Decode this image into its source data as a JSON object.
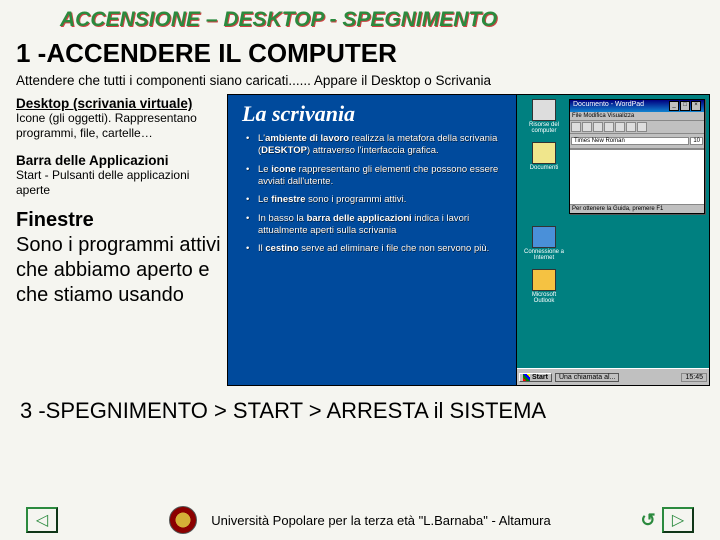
{
  "slide": {
    "title": "ACCENSIONE – DESKTOP - SPEGNIMENTO",
    "heading": "1 -ACCENDERE IL COMPUTER",
    "subtext": "Attendere che tutti i componenti siano caricati...... Appare il Desktop o Scrivania",
    "left": {
      "t1": "Desktop (scrivania virtuale)",
      "d1": "Icone (gli oggetti). Rappresentano programmi, file, cartelle…",
      "t2": "Barra delle Applicazioni",
      "d2": "Start - Pulsanti delle applicazioni aperte",
      "t3": "Finestre",
      "d3": "Sono i programmi attivi che abbiamo aperto e che stiamo usando"
    },
    "bottom": "3 -SPEGNIMENTO > START > ARRESTA il SISTEMA",
    "footer": "Università Popolare per la terza età \"L.Barnaba\" - Altamura"
  },
  "screenshot": {
    "title": "La scrivania",
    "bullets": [
      "L'ambiente di lavoro realizza la metafora della scrivania (DESKTOP) attraverso l'interfaccia grafica.",
      "Le icone rappresentano gli elementi che possono essere avviati dall'utente.",
      "Le finestre sono i programmi attivi.",
      "In basso la barra delle applicazioni indica i lavori attualmente aperti sulla scrivania",
      "Il cestino serve ad eliminare i file che non servono più."
    ],
    "desk_icons": [
      "Risorse del computer",
      "Documenti",
      "Connessione a Internet",
      "Microsoft Outlook"
    ],
    "wordpad": {
      "title": "Documento - WordPad",
      "menu": "File Modifica Visualizza",
      "font": "Times New Roman",
      "status": "Per ottenere la Guida, premere F1"
    },
    "taskbar": {
      "start": "Start",
      "task": "Una chiamata al...",
      "clock": "15:45"
    }
  }
}
